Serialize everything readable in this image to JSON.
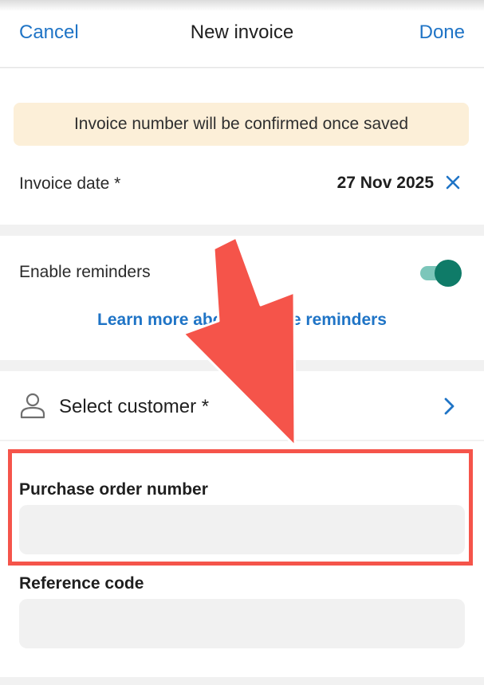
{
  "header": {
    "cancel_label": "Cancel",
    "title": "New invoice",
    "done_label": "Done"
  },
  "banner": {
    "text": "Invoice number will be confirmed once saved"
  },
  "invoice_date": {
    "label": "Invoice date *",
    "value": "27 Nov 2025",
    "clear_icon": "close-icon"
  },
  "reminders": {
    "label": "Enable reminders",
    "enabled": true,
    "learn_more_link": "Learn more about invoice reminders"
  },
  "customer": {
    "label": "Select customer *",
    "icon": "person-icon",
    "chevron": "chevron-right-icon"
  },
  "fields": {
    "purchase_order": {
      "label": "Purchase order number",
      "value": ""
    },
    "reference_code": {
      "label": "Reference code",
      "value": ""
    }
  },
  "colors": {
    "accent": "#1f74c6",
    "toggle_on": "#0f7b68",
    "banner_bg": "#fcefd8",
    "annotation": "#f5544a"
  }
}
